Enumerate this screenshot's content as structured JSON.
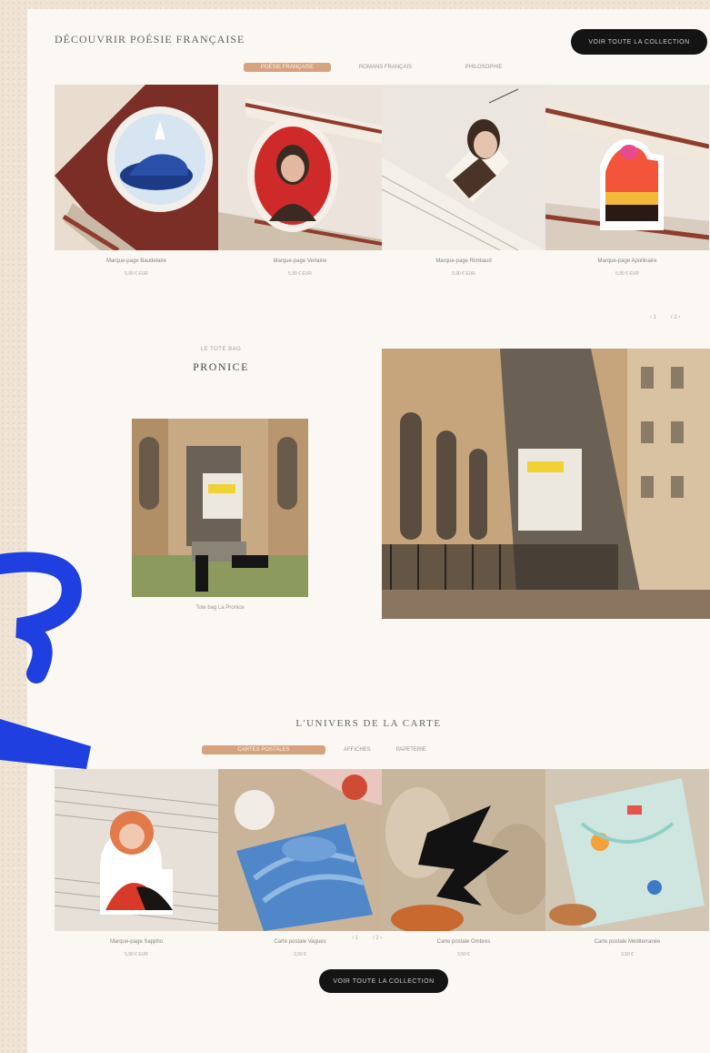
{
  "section1": {
    "title": "DÉCOUVRIR POÉSIE FRANÇAISE",
    "cta_label": "VOIR TOUTE LA COLLECTION",
    "tabs": [
      {
        "label": "POÉSIE FRANÇAISE",
        "active": true
      },
      {
        "label": "ROMANS FRANÇAIS",
        "active": false
      },
      {
        "label": "PHILOSOPHIE",
        "active": false
      }
    ],
    "products": [
      {
        "name": "Marque-page Baudelaire",
        "price": "5,90 € EUR",
        "icon": "whale-bookmark-icon"
      },
      {
        "name": "Marque-page Verlaine",
        "price": "5,90 € EUR",
        "icon": "portrait-bookmark-icon"
      },
      {
        "name": "Marque-page Rimbaud",
        "price": "5,90 € EUR",
        "icon": "poet-bookmark-icon"
      },
      {
        "name": "Marque-page Apollinaire",
        "price": "5,90 € EUR",
        "icon": "sunset-bookmark-icon"
      }
    ],
    "pager": {
      "prev": "‹ 1",
      "next": "/ 2 ›"
    }
  },
  "section2": {
    "kicker": "LE TOTE BAG",
    "heading": "PRONICE",
    "small_caption": "Tote bag La Pronice",
    "icon": "tote-bag-photo"
  },
  "section3": {
    "title": "L'UNIVERS DE LA CARTE",
    "tabs": [
      {
        "label": "CARTES POSTALES",
        "active": true
      },
      {
        "label": "AFFICHES",
        "active": false
      },
      {
        "label": "PAPETERIE",
        "active": false
      }
    ],
    "products": [
      {
        "name": "Marque-page Sappho",
        "price": "5,90 € EUR"
      },
      {
        "name": "Carte postale Vagues",
        "price": "3,50 €"
      },
      {
        "name": "Carte postale Ombres",
        "price": "3,50 €"
      },
      {
        "name": "Carte postale Méditerranée",
        "price": "3,50 €"
      }
    ],
    "pager": {
      "prev": "‹ 1",
      "next": "/ 2 ›"
    },
    "cta_label": "VOIR TOUTE LA COLLECTION"
  },
  "colors": {
    "page_bg": "#fbf8f4",
    "outer_bg": "#efe3d3",
    "accent_tab": "#d5a37f",
    "button_bg": "#141414",
    "scribble": "#1f3fe0"
  }
}
